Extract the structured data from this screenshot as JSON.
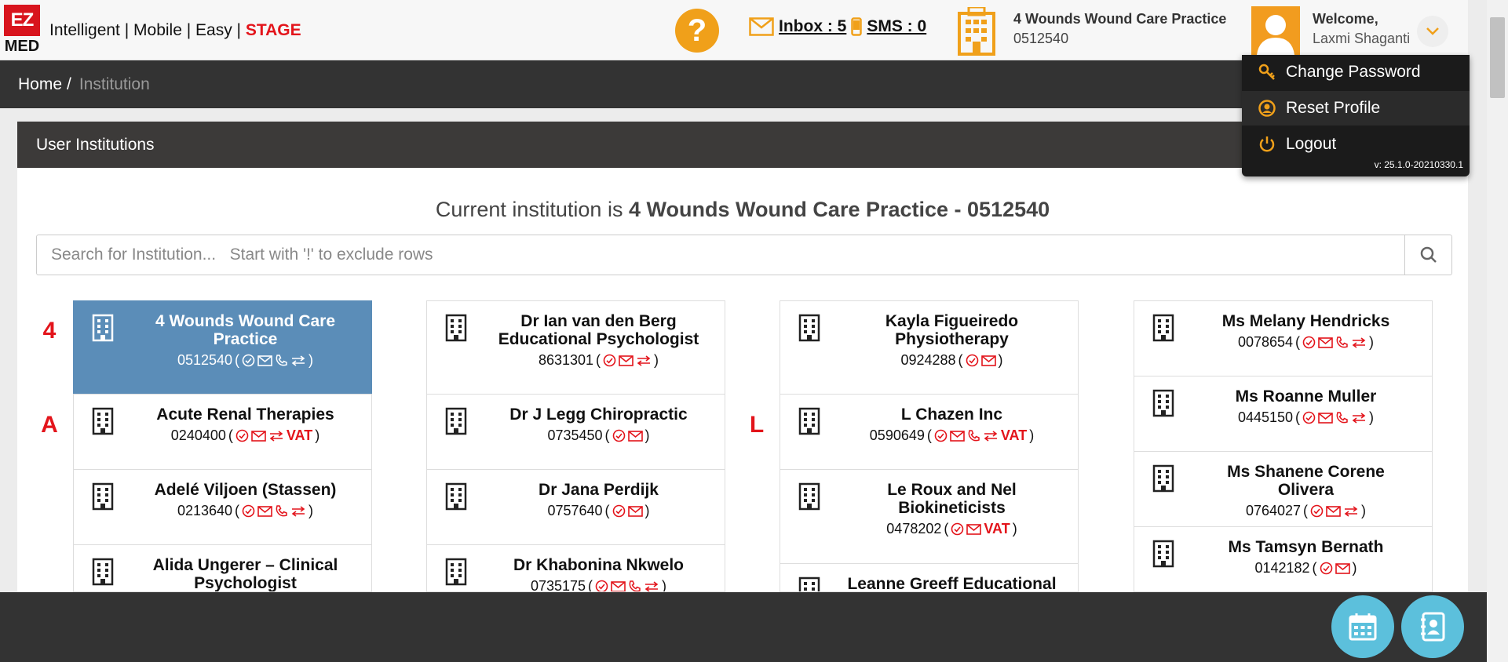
{
  "header": {
    "logo_top": "EZ",
    "logo_bottom": "MED",
    "tagline": "Intelligent | Mobile | Easy | ",
    "stage": "STAGE",
    "help": "?",
    "inbox": "Inbox : 5",
    "sms": "SMS : 0",
    "institution_name": "4 Wounds Wound Care Practice",
    "institution_code": "0512540",
    "welcome": "Welcome,",
    "user": "Laxmi Shaganti"
  },
  "dropdown": {
    "change_password": "Change Password",
    "reset_profile": "Reset Profile",
    "logout": "Logout",
    "version": "v: 25.1.0-20210330.1"
  },
  "breadcrumb": {
    "home": "Home",
    "sep": "/",
    "current": "Institution"
  },
  "panel": {
    "title": "User Institutions",
    "current_prefix": "Current institution is ",
    "current_value": "4 Wounds Wound Care Practice - 0512540",
    "search_placeholder": "Search for Institution...   Start with '!' to exclude rows"
  },
  "letters": [
    "4",
    "A",
    "L"
  ],
  "cards": [
    {
      "name": "4 Wounds Wound Care Practice",
      "code": "0512540",
      "vat": ""
    },
    {
      "name": "Acute Renal Therapies",
      "code": "0240400",
      "vat": "VAT"
    },
    {
      "name": "Adelé Viljoen (Stassen)",
      "code": "0213640",
      "vat": ""
    },
    {
      "name": "Alida Ungerer – Clinical Psychologist",
      "code": "",
      "vat": ""
    },
    {
      "name": "Dr Ian van den Berg Educational Psychologist",
      "code": "8631301",
      "vat": ""
    },
    {
      "name": "Dr J Legg Chiropractic",
      "code": "0735450",
      "vat": ""
    },
    {
      "name": "Dr Jana Perdijk",
      "code": "0757640",
      "vat": ""
    },
    {
      "name": "Dr Khabonina Nkwelo",
      "code": "0735175",
      "vat": ""
    },
    {
      "name": "Kayla Figueiredo Physiotherapy",
      "code": "0924288",
      "vat": ""
    },
    {
      "name": "L Chazen Inc",
      "code": "0590649",
      "vat": "VAT"
    },
    {
      "name": "Le Roux and Nel Biokineticists",
      "code": "0478202",
      "vat": "VAT"
    },
    {
      "name": "Leanne Greeff Educational",
      "code": "",
      "vat": ""
    },
    {
      "name": "Ms Melany Hendricks",
      "code": "0078654",
      "vat": ""
    },
    {
      "name": "Ms Roanne Muller",
      "code": "0445150",
      "vat": ""
    },
    {
      "name": "Ms Shanene Corene Olivera",
      "code": "0764027",
      "vat": ""
    },
    {
      "name": "Ms Tamsyn Bernath",
      "code": "0142182",
      "vat": ""
    }
  ],
  "colors": {
    "accent": "#f0a01a",
    "red": "#e3141b",
    "selected": "#5b8db8",
    "fab": "#5cc0dc"
  }
}
